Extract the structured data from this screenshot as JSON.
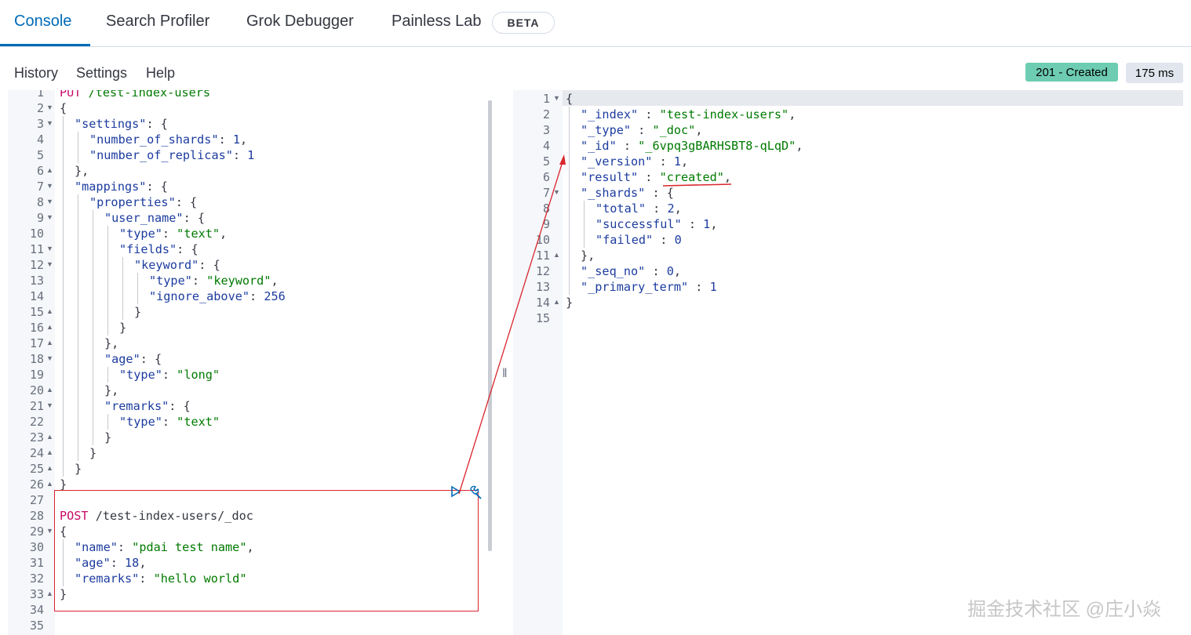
{
  "tabs": [
    {
      "label": "Console"
    },
    {
      "label": "Search Profiler"
    },
    {
      "label": "Grok Debugger"
    },
    {
      "label": "Painless Lab"
    }
  ],
  "beta_label": "BETA",
  "subnav": {
    "history": "History",
    "settings": "Settings",
    "help": "Help"
  },
  "status": {
    "code_text": "201 - Created",
    "time_text": "175 ms",
    "status_color": "#6dccb1"
  },
  "request_editor": {
    "lines": [
      {
        "n": "1",
        "fold": "",
        "indent": 0,
        "tokens": [
          [
            "m",
            "PUT"
          ],
          [
            "p",
            " "
          ],
          [
            "s",
            "/test-index-users"
          ]
        ]
      },
      {
        "n": "2",
        "fold": "open",
        "indent": 0,
        "tokens": [
          [
            "p",
            "{"
          ]
        ]
      },
      {
        "n": "3",
        "fold": "open",
        "indent": 1,
        "tokens": [
          [
            "k",
            "\"settings\""
          ],
          [
            "p",
            ": {"
          ]
        ]
      },
      {
        "n": "4",
        "fold": "",
        "indent": 2,
        "tokens": [
          [
            "k",
            "\"number_of_shards\""
          ],
          [
            "p",
            ": "
          ],
          [
            "k",
            "1"
          ],
          [
            "p",
            ","
          ]
        ]
      },
      {
        "n": "5",
        "fold": "",
        "indent": 2,
        "tokens": [
          [
            "k",
            "\"number_of_replicas\""
          ],
          [
            "p",
            ": "
          ],
          [
            "k",
            "1"
          ]
        ]
      },
      {
        "n": "6",
        "fold": "close",
        "indent": 1,
        "tokens": [
          [
            "p",
            "},"
          ]
        ]
      },
      {
        "n": "7",
        "fold": "open",
        "indent": 1,
        "tokens": [
          [
            "k",
            "\"mappings\""
          ],
          [
            "p",
            ": {"
          ]
        ]
      },
      {
        "n": "8",
        "fold": "open",
        "indent": 2,
        "tokens": [
          [
            "k",
            "\"properties\""
          ],
          [
            "p",
            ": {"
          ]
        ]
      },
      {
        "n": "9",
        "fold": "open",
        "indent": 3,
        "tokens": [
          [
            "k",
            "\"user_name\""
          ],
          [
            "p",
            ": {"
          ]
        ]
      },
      {
        "n": "10",
        "fold": "",
        "indent": 4,
        "tokens": [
          [
            "k",
            "\"type\""
          ],
          [
            "p",
            ": "
          ],
          [
            "s",
            "\"text\""
          ],
          [
            "p",
            ","
          ]
        ]
      },
      {
        "n": "11",
        "fold": "open",
        "indent": 4,
        "tokens": [
          [
            "k",
            "\"fields\""
          ],
          [
            "p",
            ": {"
          ]
        ]
      },
      {
        "n": "12",
        "fold": "open",
        "indent": 5,
        "tokens": [
          [
            "k",
            "\"keyword\""
          ],
          [
            "p",
            ": {"
          ]
        ]
      },
      {
        "n": "13",
        "fold": "",
        "indent": 6,
        "tokens": [
          [
            "k",
            "\"type\""
          ],
          [
            "p",
            ": "
          ],
          [
            "s",
            "\"keyword\""
          ],
          [
            "p",
            ","
          ]
        ]
      },
      {
        "n": "14",
        "fold": "",
        "indent": 6,
        "tokens": [
          [
            "k",
            "\"ignore_above\""
          ],
          [
            "p",
            ": "
          ],
          [
            "k",
            "256"
          ]
        ]
      },
      {
        "n": "15",
        "fold": "close",
        "indent": 5,
        "tokens": [
          [
            "p",
            "}"
          ]
        ]
      },
      {
        "n": "16",
        "fold": "close",
        "indent": 4,
        "tokens": [
          [
            "p",
            "}"
          ]
        ]
      },
      {
        "n": "17",
        "fold": "close",
        "indent": 3,
        "tokens": [
          [
            "p",
            "},"
          ]
        ]
      },
      {
        "n": "18",
        "fold": "open",
        "indent": 3,
        "tokens": [
          [
            "k",
            "\"age\""
          ],
          [
            "p",
            ": {"
          ]
        ]
      },
      {
        "n": "19",
        "fold": "",
        "indent": 4,
        "tokens": [
          [
            "k",
            "\"type\""
          ],
          [
            "p",
            ": "
          ],
          [
            "s",
            "\"long\""
          ]
        ]
      },
      {
        "n": "20",
        "fold": "close",
        "indent": 3,
        "tokens": [
          [
            "p",
            "},"
          ]
        ]
      },
      {
        "n": "21",
        "fold": "open",
        "indent": 3,
        "tokens": [
          [
            "k",
            "\"remarks\""
          ],
          [
            "p",
            ": {"
          ]
        ]
      },
      {
        "n": "22",
        "fold": "",
        "indent": 4,
        "tokens": [
          [
            "k",
            "\"type\""
          ],
          [
            "p",
            ": "
          ],
          [
            "s",
            "\"text\""
          ]
        ]
      },
      {
        "n": "23",
        "fold": "close",
        "indent": 3,
        "tokens": [
          [
            "p",
            "}"
          ]
        ]
      },
      {
        "n": "24",
        "fold": "close",
        "indent": 2,
        "tokens": [
          [
            "p",
            "}"
          ]
        ]
      },
      {
        "n": "25",
        "fold": "close",
        "indent": 1,
        "tokens": [
          [
            "p",
            "}"
          ]
        ]
      },
      {
        "n": "26",
        "fold": "close",
        "indent": 0,
        "tokens": [
          [
            "p",
            "}"
          ]
        ]
      },
      {
        "n": "27",
        "fold": "",
        "indent": 0,
        "tokens": []
      },
      {
        "n": "28",
        "fold": "",
        "indent": 0,
        "tokens": [
          [
            "m",
            "POST"
          ],
          [
            "p",
            " /test-index-users/_doc"
          ]
        ]
      },
      {
        "n": "29",
        "fold": "open",
        "indent": 0,
        "tokens": [
          [
            "p",
            "{"
          ]
        ]
      },
      {
        "n": "30",
        "fold": "",
        "indent": 1,
        "tokens": [
          [
            "k",
            "\"name\""
          ],
          [
            "p",
            ": "
          ],
          [
            "s",
            "\"pdai test name\""
          ],
          [
            "p",
            ","
          ]
        ]
      },
      {
        "n": "31",
        "fold": "",
        "indent": 1,
        "tokens": [
          [
            "k",
            "\"age\""
          ],
          [
            "p",
            ": "
          ],
          [
            "k",
            "18"
          ],
          [
            "p",
            ","
          ]
        ]
      },
      {
        "n": "32",
        "fold": "",
        "indent": 1,
        "tokens": [
          [
            "k",
            "\"remarks\""
          ],
          [
            "p",
            ": "
          ],
          [
            "s",
            "\"hello world\""
          ]
        ]
      },
      {
        "n": "33",
        "fold": "close",
        "indent": 0,
        "tokens": [
          [
            "p",
            "}"
          ]
        ]
      },
      {
        "n": "34",
        "fold": "",
        "indent": 0,
        "tokens": []
      },
      {
        "n": "35",
        "fold": "",
        "indent": 0,
        "tokens": []
      }
    ]
  },
  "response_editor": {
    "lines": [
      {
        "n": "1",
        "fold": "open",
        "indent": 0,
        "tokens": [
          [
            "p",
            "{"
          ]
        ]
      },
      {
        "n": "2",
        "fold": "",
        "indent": 1,
        "tokens": [
          [
            "k",
            "\"_index\""
          ],
          [
            "p",
            " : "
          ],
          [
            "s",
            "\"test-index-users\""
          ],
          [
            "p",
            ","
          ]
        ]
      },
      {
        "n": "3",
        "fold": "",
        "indent": 1,
        "tokens": [
          [
            "k",
            "\"_type\""
          ],
          [
            "p",
            " : "
          ],
          [
            "s",
            "\"_doc\""
          ],
          [
            "p",
            ","
          ]
        ]
      },
      {
        "n": "4",
        "fold": "",
        "indent": 1,
        "tokens": [
          [
            "k",
            "\"_id\""
          ],
          [
            "p",
            " : "
          ],
          [
            "s",
            "\"_6vpq3gBARHSBT8-qLqD\""
          ],
          [
            "p",
            ","
          ]
        ]
      },
      {
        "n": "5",
        "fold": "",
        "indent": 1,
        "tokens": [
          [
            "k",
            "\"_version\""
          ],
          [
            "p",
            " : "
          ],
          [
            "k",
            "1"
          ],
          [
            "p",
            ","
          ]
        ]
      },
      {
        "n": "6",
        "fold": "",
        "indent": 1,
        "tokens": [
          [
            "k",
            "\"result\""
          ],
          [
            "p",
            " : "
          ],
          [
            "s",
            "\"created\""
          ],
          [
            "p",
            ","
          ]
        ]
      },
      {
        "n": "7",
        "fold": "open",
        "indent": 1,
        "tokens": [
          [
            "k",
            "\"_shards\""
          ],
          [
            "p",
            " : {"
          ]
        ]
      },
      {
        "n": "8",
        "fold": "",
        "indent": 2,
        "tokens": [
          [
            "k",
            "\"total\""
          ],
          [
            "p",
            " : "
          ],
          [
            "k",
            "2"
          ],
          [
            "p",
            ","
          ]
        ]
      },
      {
        "n": "9",
        "fold": "",
        "indent": 2,
        "tokens": [
          [
            "k",
            "\"successful\""
          ],
          [
            "p",
            " : "
          ],
          [
            "k",
            "1"
          ],
          [
            "p",
            ","
          ]
        ]
      },
      {
        "n": "10",
        "fold": "",
        "indent": 2,
        "tokens": [
          [
            "k",
            "\"failed\""
          ],
          [
            "p",
            " : "
          ],
          [
            "k",
            "0"
          ]
        ]
      },
      {
        "n": "11",
        "fold": "close",
        "indent": 1,
        "tokens": [
          [
            "p",
            "},"
          ]
        ]
      },
      {
        "n": "12",
        "fold": "",
        "indent": 1,
        "tokens": [
          [
            "k",
            "\"_seq_no\""
          ],
          [
            "p",
            " : "
          ],
          [
            "k",
            "0"
          ],
          [
            "p",
            ","
          ]
        ]
      },
      {
        "n": "13",
        "fold": "",
        "indent": 1,
        "tokens": [
          [
            "k",
            "\"_primary_term\""
          ],
          [
            "p",
            " : "
          ],
          [
            "k",
            "1"
          ]
        ]
      },
      {
        "n": "14",
        "fold": "close",
        "indent": 0,
        "tokens": [
          [
            "p",
            "}"
          ]
        ]
      },
      {
        "n": "15",
        "fold": "",
        "indent": 0,
        "tokens": []
      }
    ]
  },
  "watermark": "掘金技术社区 @庄小焱",
  "icons": {
    "play": "play-icon",
    "wrench": "wrench-icon",
    "resize": "resize-handle-icon"
  }
}
